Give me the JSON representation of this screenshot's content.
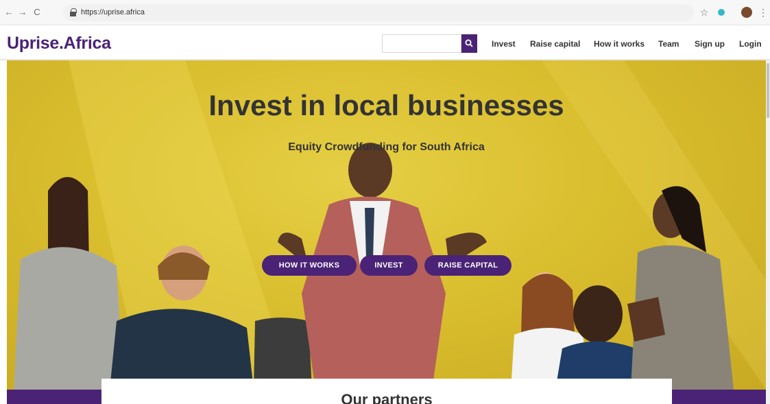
{
  "browser": {
    "url": "https://uprise.africa",
    "back_icon": "←",
    "forward_icon": "→",
    "reload_icon": "C",
    "star_icon": "☆",
    "menu_icon": "⋮"
  },
  "site": {
    "logo": "Uprise.Africa",
    "search": {
      "placeholder": "",
      "value": ""
    },
    "nav": [
      "Invest",
      "Raise capital",
      "How it works",
      "Team",
      "Sign up",
      "Login"
    ]
  },
  "hero": {
    "title": "Invest in local businesses",
    "subtitle": "Equity Crowdfunding for South Africa",
    "buttons": [
      "HOW IT WORKS",
      "INVEST",
      "RAISE CAPITAL"
    ]
  },
  "partners": {
    "title": "Our partners"
  },
  "colors": {
    "brand": "#4a2376",
    "hero_yellow": "#dcc235",
    "text": "#333333"
  }
}
